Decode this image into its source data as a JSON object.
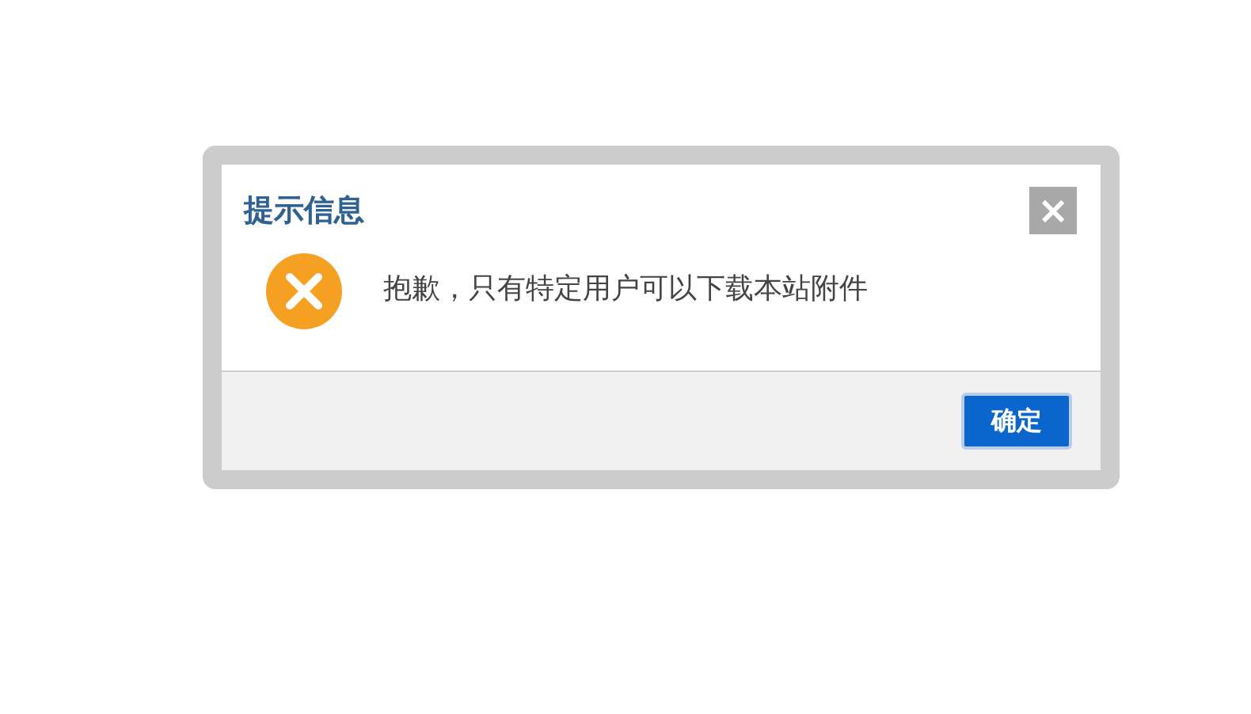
{
  "dialog": {
    "title": "提示信息",
    "close": "×",
    "kind": "error",
    "message": "抱歉，只有特定用户可以下载本站附件",
    "buttons": [
      "确定"
    ]
  }
}
